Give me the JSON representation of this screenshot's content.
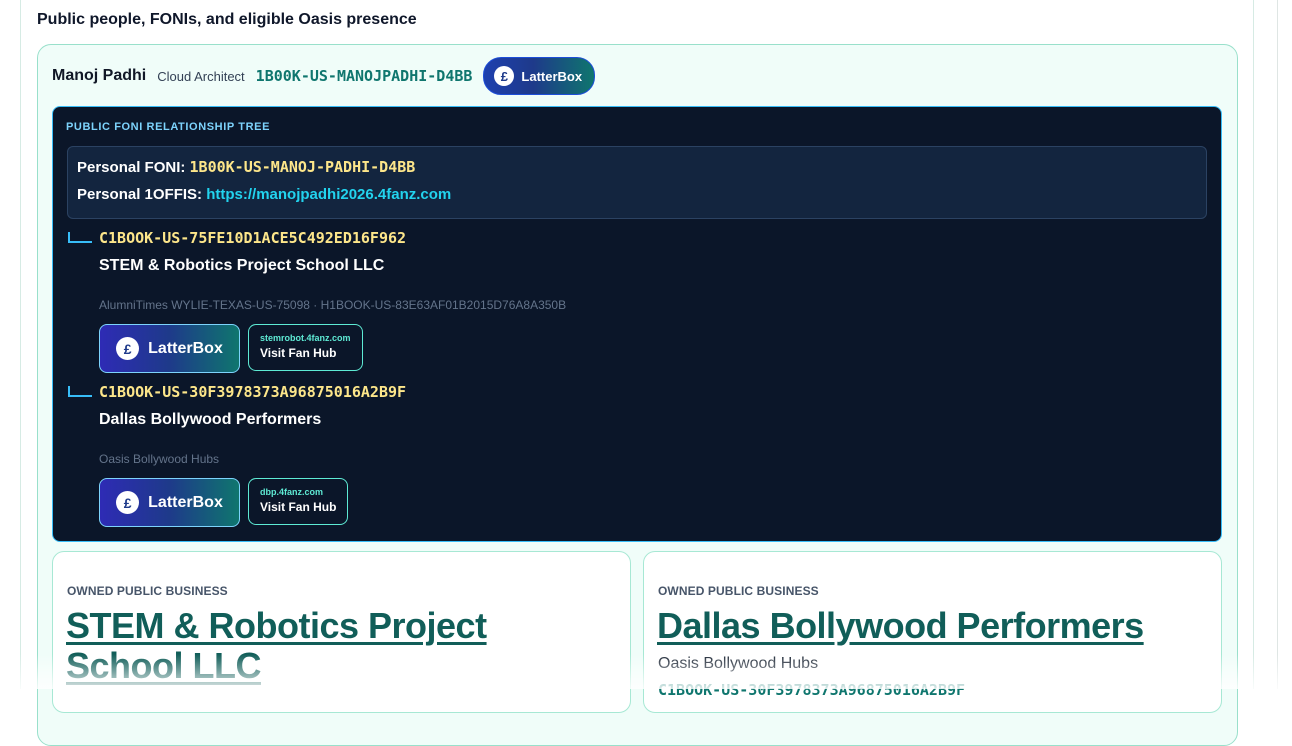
{
  "section": {
    "title": "Public people, FONIs, and eligible Oasis presence"
  },
  "person": {
    "name": "Manoj Padhi",
    "role": "Cloud Architect",
    "code": "1B00K-US-MANOJPADHI-D4BB",
    "latterbox_label": "LatterBox",
    "pound_symbol": "£"
  },
  "tree": {
    "heading": "PUBLIC FONI RELATIONSHIP TREE",
    "personal_foni_label": "Personal FONI:",
    "personal_foni_value": "1B00K-US-MANOJ-PADHI-D4BB",
    "personal_1offis_label": "Personal 1OFFIS:",
    "personal_1offis_value": "https://manojpadhi2026.4fanz.com",
    "branches": [
      {
        "code": "C1BOOK-US-75FE10D1ACE5C492ED16F962",
        "name": "STEM & Robotics Project School LLC",
        "meta": "AlumniTimes WYLIE-TEXAS-US-75098 · H1BOOK-US-83E63AF01B2015D76A8A350B",
        "latterbox_label": "LatterBox",
        "hub_domain": "stemrobot.4fanz.com",
        "hub_label": "Visit Fan Hub"
      },
      {
        "code": "C1BOOK-US-30F3978373A96875016A2B9F",
        "name": "Dallas Bollywood Performers",
        "meta": "Oasis Bollywood Hubs",
        "latterbox_label": "LatterBox",
        "hub_domain": "dbp.4fanz.com",
        "hub_label": "Visit Fan Hub"
      }
    ]
  },
  "businesses": [
    {
      "kicker": "OWNED PUBLIC BUSINESS",
      "title_line1": "STEM & Robotics Project",
      "title_line2": "School LLC"
    },
    {
      "kicker": "OWNED PUBLIC BUSINESS",
      "title_line1": "Dallas Bollywood Performers",
      "subtitle": "Oasis Bollywood Hubs",
      "code_peek": "C1BOOK-US-30F3978373A96875016A2B9F"
    }
  ]
}
